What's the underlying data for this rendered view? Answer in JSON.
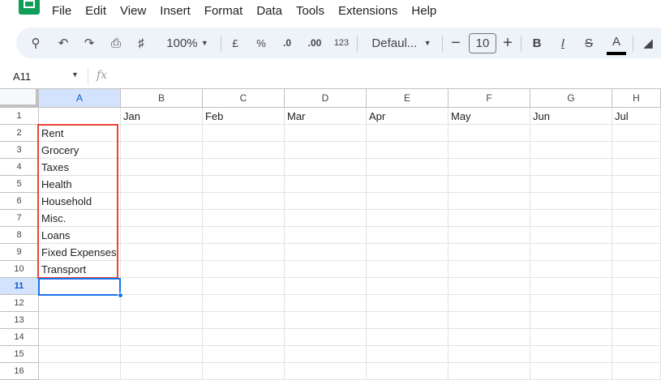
{
  "menu": [
    "File",
    "Edit",
    "View",
    "Insert",
    "Format",
    "Data",
    "Tools",
    "Extensions",
    "Help"
  ],
  "toolbar": {
    "zoom": "100%",
    "currency": "£",
    "percent": "%",
    "dec_decrease": ".0",
    "dec_increase": ".00",
    "number_format": "123",
    "font": "Defaul...",
    "font_size": "10",
    "bold": "B",
    "italic": "I",
    "text_color": "A"
  },
  "formula_bar": {
    "name_box": "A11",
    "fx": "fx",
    "value": ""
  },
  "columns": [
    "A",
    "B",
    "C",
    "D",
    "E",
    "F",
    "G",
    "H"
  ],
  "rows": [
    "1",
    "2",
    "3",
    "4",
    "5",
    "6",
    "7",
    "8",
    "9",
    "10",
    "11",
    "12",
    "13",
    "14",
    "15",
    "16"
  ],
  "row1": [
    "",
    "Jan",
    "Feb",
    "Mar",
    "Apr",
    "May",
    "Jun",
    "Jul"
  ],
  "colA": [
    "",
    "Rent",
    "Grocery",
    "Taxes",
    "Health",
    "Household",
    "Misc.",
    "Loans",
    "Fixed Expenses",
    "Transport"
  ],
  "selected_cell": "A11",
  "colors": {
    "highlight": "#ea4335",
    "selection": "#1a73e8",
    "brand": "#0f9d58"
  }
}
